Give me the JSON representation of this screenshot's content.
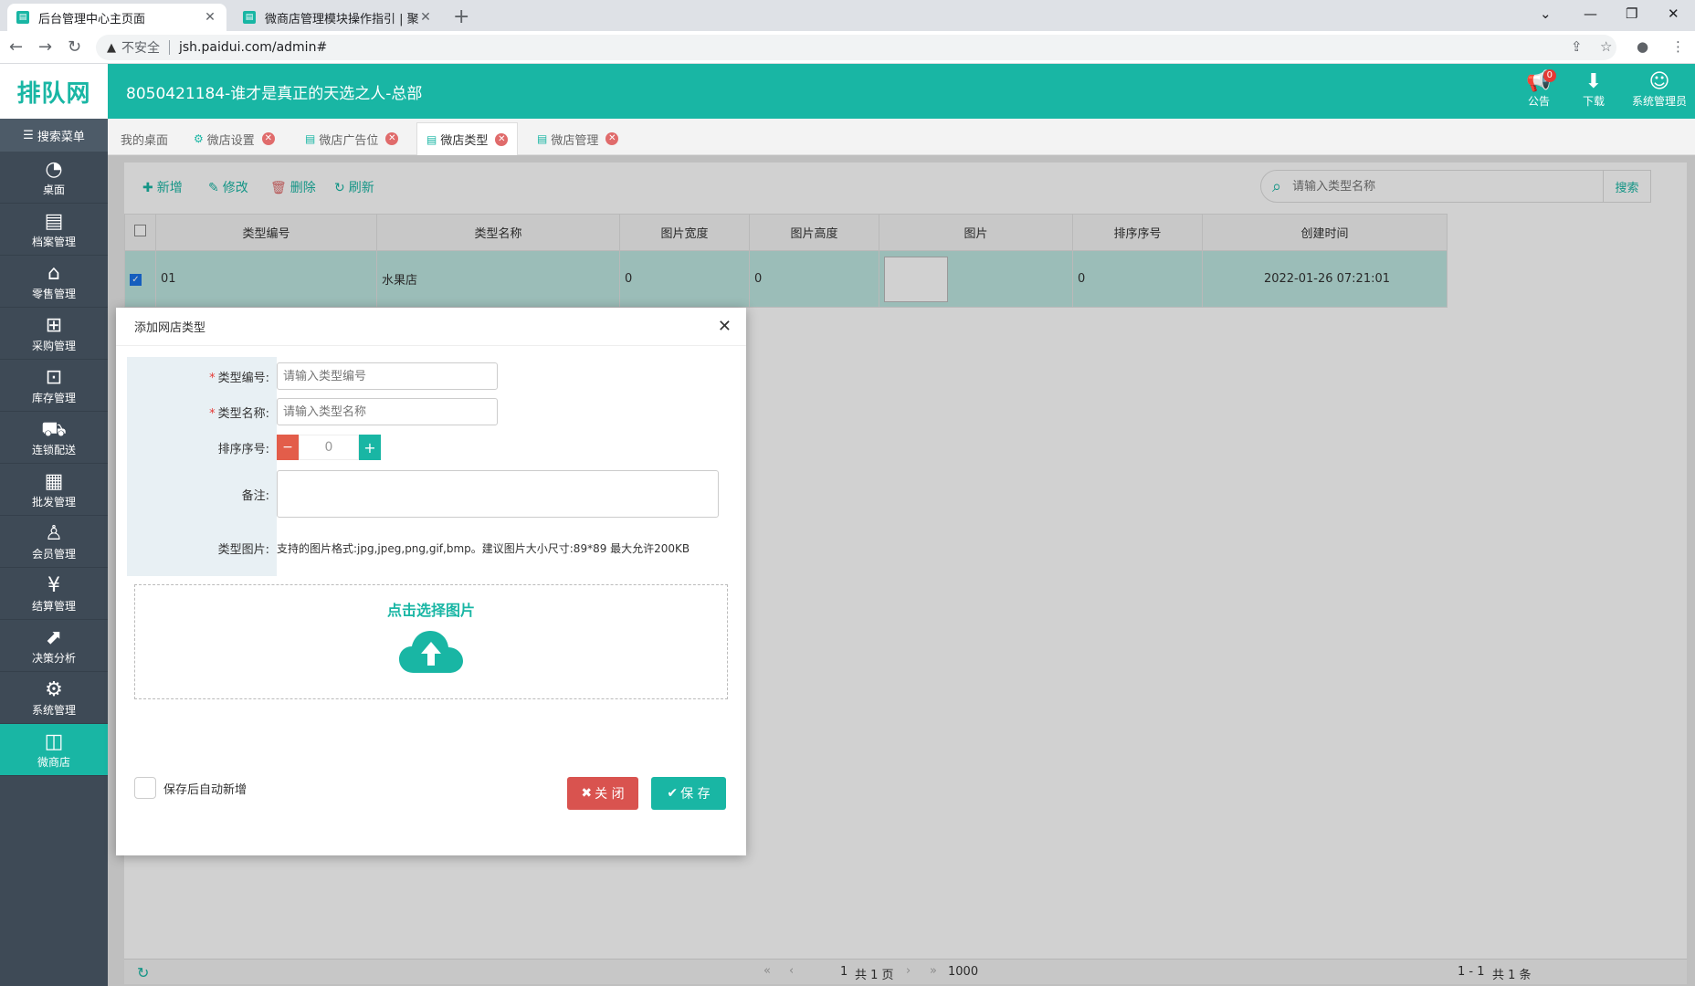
{
  "browser": {
    "tabs": [
      {
        "title": "后台管理中心主页面",
        "close": "✕"
      },
      {
        "title": "微商店管理模块操作指引 | 聚商云",
        "close": "✕"
      }
    ],
    "new_tab": "+",
    "insecure_label": "不安全",
    "url": "jsh.paidui.com/admin#",
    "window_controls": [
      "⌄",
      "—",
      "❐",
      "✕"
    ]
  },
  "header": {
    "logo": "排队网",
    "company": "8050421184-谁才是真正的天选之人-总部",
    "notice_label": "公告",
    "notice_badge": "0",
    "download_label": "下载",
    "user_label": "系统管理员"
  },
  "sidebar": {
    "search_label": "搜索菜单",
    "items": [
      {
        "label": "桌面",
        "icon": "dashboard-icon"
      },
      {
        "label": "档案管理",
        "icon": "archive-icon"
      },
      {
        "label": "零售管理",
        "icon": "store-icon"
      },
      {
        "label": "采购管理",
        "icon": "cart-icon"
      },
      {
        "label": "库存管理",
        "icon": "inventory-icon"
      },
      {
        "label": "连锁配送",
        "icon": "truck-icon"
      },
      {
        "label": "批发管理",
        "icon": "wholesale-icon"
      },
      {
        "label": "会员管理",
        "icon": "member-icon"
      },
      {
        "label": "结算管理",
        "icon": "settlement-icon"
      },
      {
        "label": "决策分析",
        "icon": "chart-icon"
      },
      {
        "label": "系统管理",
        "icon": "gear-icon"
      },
      {
        "label": "微商店",
        "icon": "bag-icon"
      }
    ]
  },
  "page_tabs": [
    {
      "label": "我的桌面"
    },
    {
      "label": "微店设置"
    },
    {
      "label": "微店广告位"
    },
    {
      "label": "微店类型"
    },
    {
      "label": "微店管理"
    }
  ],
  "toolbar": {
    "add": "新增",
    "edit": "修改",
    "delete": "删除",
    "refresh": "刷新",
    "search_placeholder": "请输入类型名称",
    "search_button": "搜索"
  },
  "table": {
    "columns": [
      "类型编号",
      "类型名称",
      "图片宽度",
      "图片高度",
      "图片",
      "排序序号",
      "创建时间"
    ],
    "rows": [
      {
        "code": "01",
        "name": "水果店",
        "width": "0",
        "height": "0",
        "sort": "0",
        "created": "2022-01-26 07:21:01"
      }
    ]
  },
  "pager": {
    "page": "1",
    "total_pages": "共 1 页",
    "page_size": "1000",
    "range": "1 - 1",
    "total": "共 1 条"
  },
  "modal": {
    "title": "添加网店类型",
    "code_label": "类型编号:",
    "code_placeholder": "请输入类型编号",
    "name_label": "类型名称:",
    "name_placeholder": "请输入类型名称",
    "sort_label": "排序序号:",
    "sort_value": "0",
    "remark_label": "备注:",
    "image_label": "类型图片:",
    "image_hint": "支持的图片格式:jpg,jpeg,png,gif,bmp。建议图片大小尺寸:89*89 最大允许200KB",
    "upload_text": "点击选择图片",
    "autosave_label": "保存后自动新增",
    "close_button": "关 闭",
    "save_button": "保 存"
  },
  "colors": {
    "brand": "#19b6a4",
    "sidebar": "#3e4a56",
    "danger": "#d9534f"
  }
}
